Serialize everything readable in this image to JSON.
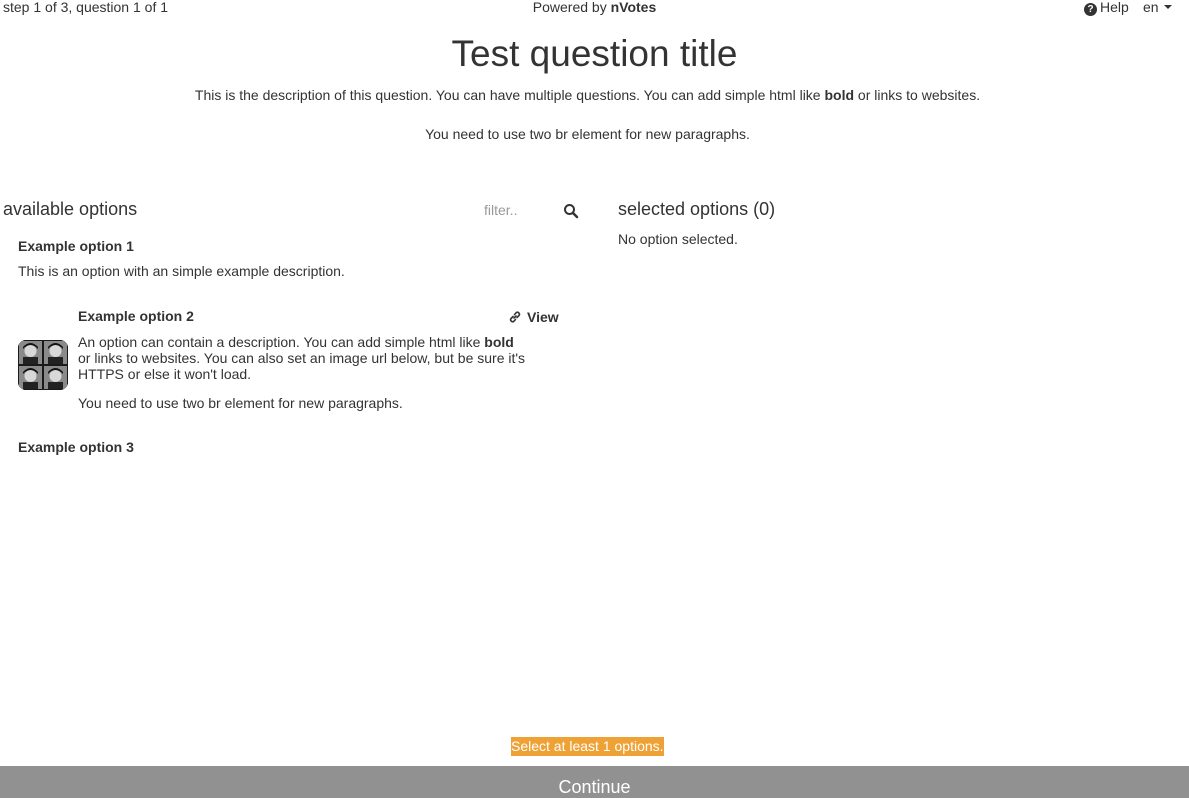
{
  "topbar": {
    "step_info": "step 1 of 3, question 1 of 1",
    "powered_prefix": "Powered by",
    "powered_brand": "nVotes",
    "help_label": "Help",
    "help_icon": "question-circle-icon",
    "language": "en"
  },
  "question": {
    "title": "Test question title",
    "description_part1": "This is the description of this question. You can have multiple questions. You can add simple html like ",
    "description_bold": "bold",
    "description_part2": " or links to websites.",
    "description_paragraph2": "You need to use two br element for new paragraphs."
  },
  "available": {
    "title": "available options",
    "filter_placeholder": "filter..",
    "options": [
      {
        "title": "Example option 1",
        "description": "This is an option with an simple example description."
      },
      {
        "title": "Example option 2",
        "view_label": "View",
        "description_part1": "An option can contain a description. You can add simple html like ",
        "description_bold": "bold",
        "description_part2": " or links to websites. You can also set an image url below, but be sure it's HTTPS or else it won't load.",
        "description_paragraph2": "You need to use two br element for new paragraphs."
      },
      {
        "title": "Example option 3"
      }
    ]
  },
  "selected": {
    "title": "selected options (0)",
    "empty_text": "No option selected."
  },
  "footer": {
    "warning": "Select at least 1 options.",
    "continue_label": "Continue"
  },
  "colors": {
    "warning_bg": "#eea236",
    "continue_bg": "#919191",
    "text": "#333333"
  }
}
